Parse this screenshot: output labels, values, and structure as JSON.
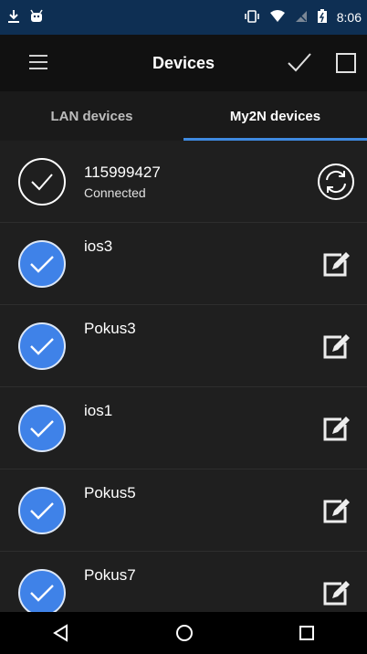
{
  "status_bar": {
    "time": "8:06",
    "icons": [
      "download-icon",
      "android-icon",
      "vibrate-icon",
      "wifi-icon",
      "signal-icon",
      "battery-icon"
    ]
  },
  "app_bar": {
    "title": "Devices",
    "icons": [
      "menu-icon",
      "check-icon",
      "checkbox-icon"
    ]
  },
  "tabs": [
    {
      "label": "LAN devices",
      "active": false
    },
    {
      "label": "My2N devices",
      "active": true
    }
  ],
  "devices": [
    {
      "name": "115999427",
      "status": "Connected",
      "selected": false,
      "action_icon": "sync-icon"
    },
    {
      "name": "ios3",
      "status": "",
      "selected": true,
      "action_icon": "edit-icon"
    },
    {
      "name": "Pokus3",
      "status": "",
      "selected": true,
      "action_icon": "edit-icon"
    },
    {
      "name": "ios1",
      "status": "",
      "selected": true,
      "action_icon": "edit-icon"
    },
    {
      "name": "Pokus5",
      "status": "",
      "selected": true,
      "action_icon": "edit-icon"
    },
    {
      "name": "Pokus7",
      "status": "",
      "selected": true,
      "action_icon": "edit-icon"
    }
  ],
  "nav_bar": {
    "icons": [
      "back-icon",
      "home-icon",
      "recents-icon"
    ]
  },
  "colors": {
    "status_bar": "#0e2f53",
    "app_bar": "#111111",
    "background": "#1f1f1f",
    "accent": "#3f82e8",
    "tab_indicator": "#3f8ae0"
  }
}
